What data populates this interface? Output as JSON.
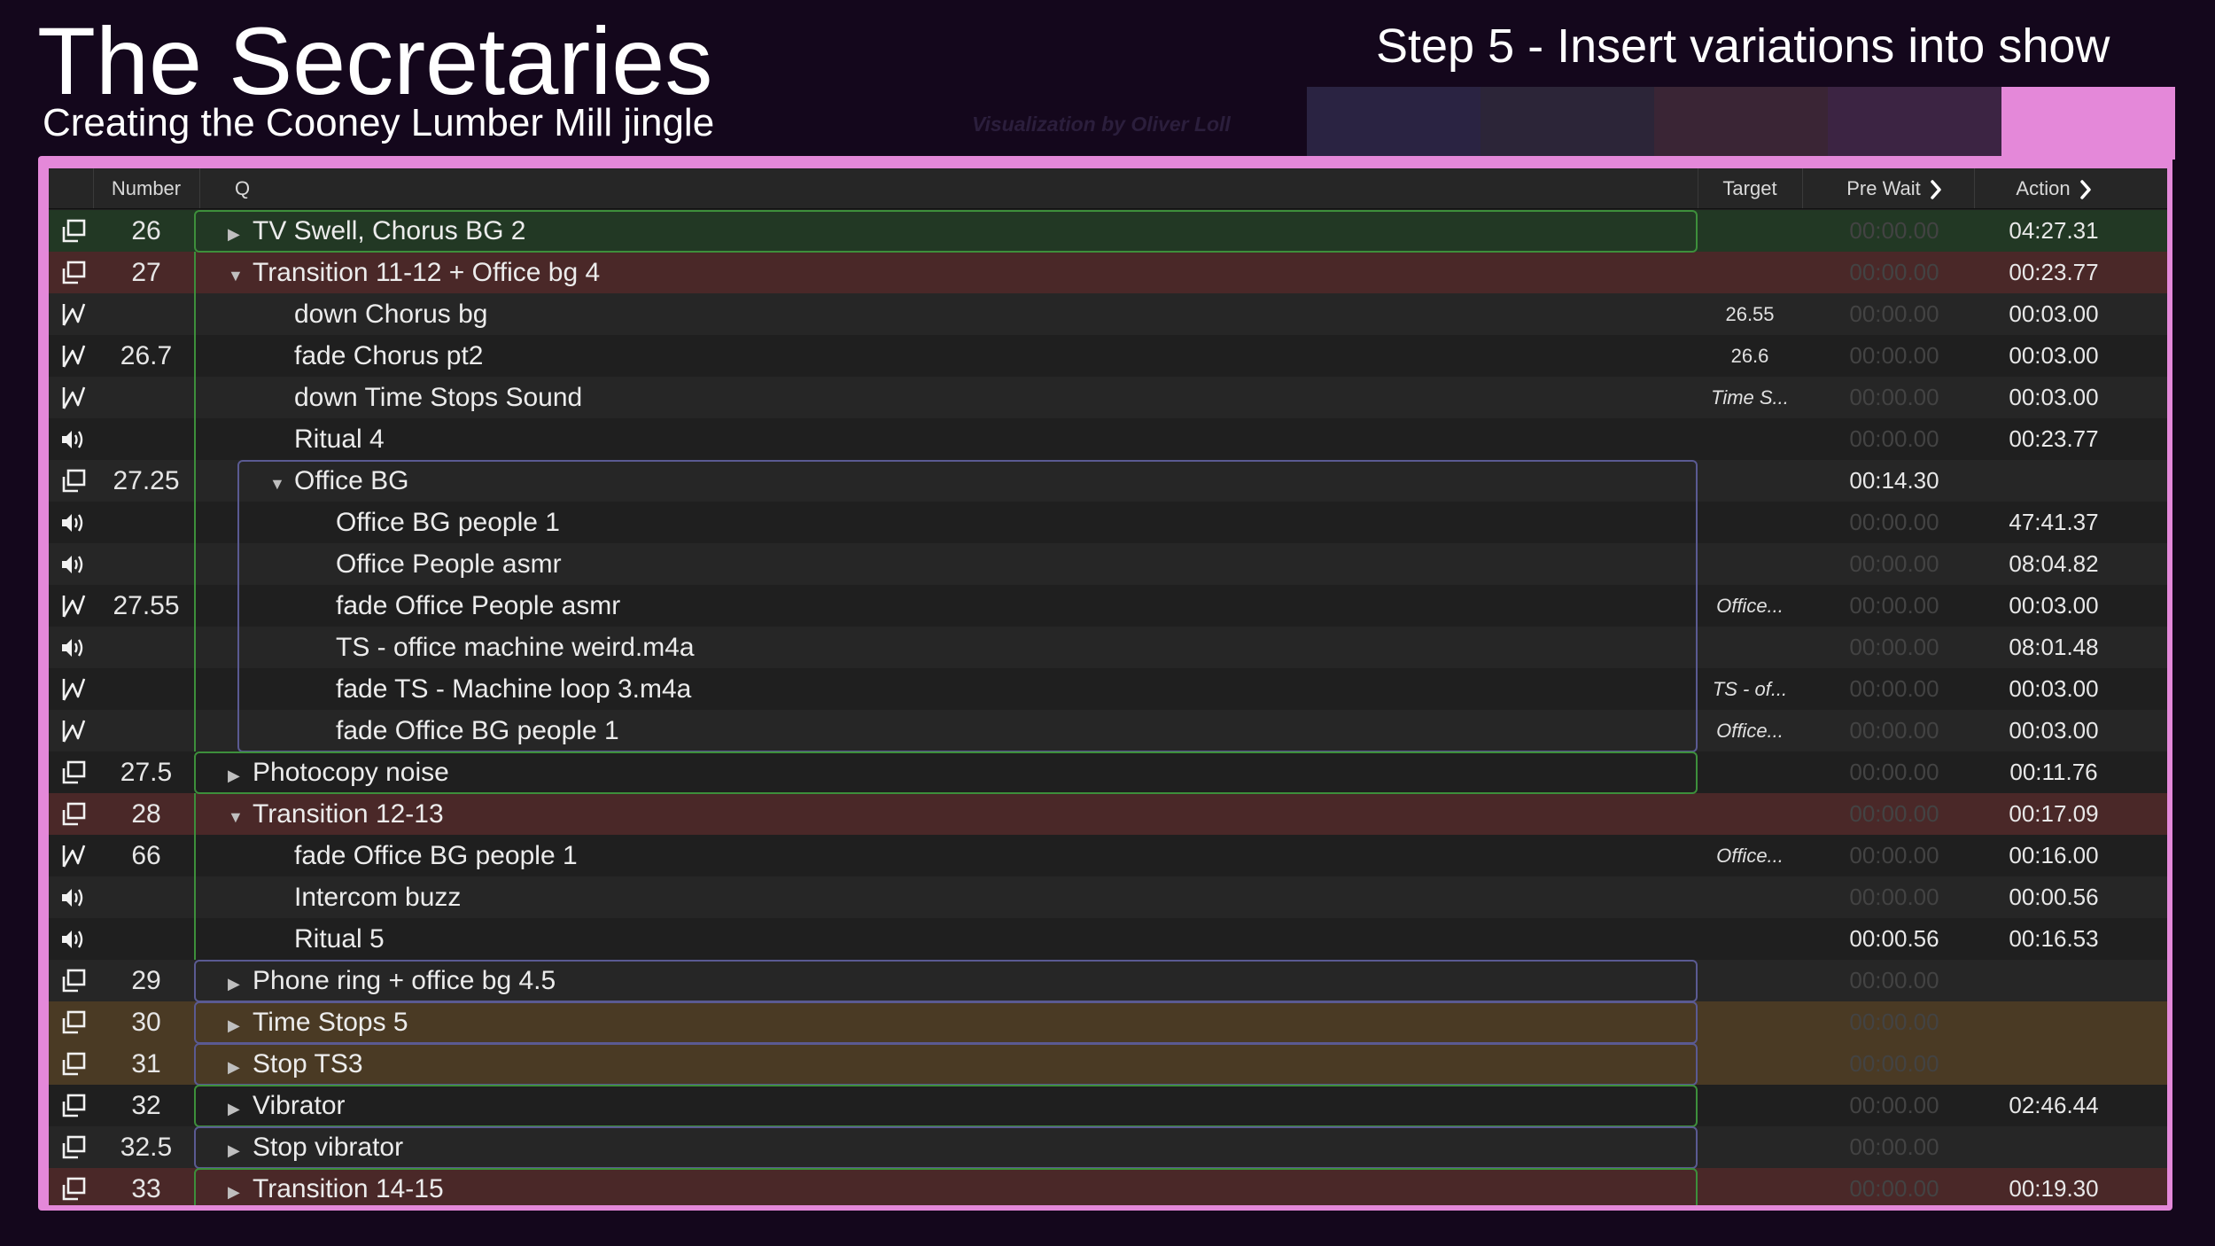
{
  "header": {
    "title": "The Secretaries",
    "subtitle": "Creating the Cooney Lumber Mill jingle",
    "step": "Step 5 - Insert variations into show",
    "credit": "Visualization by Oliver Loll"
  },
  "colors": {
    "frame": "#e488d9",
    "row_green": "#223824",
    "row_red": "#4a2828",
    "row_orange": "#4a3a24",
    "group_green": "#3d8f3b",
    "group_blue": "#5a5a92",
    "swatches": [
      "#2a2342",
      "#2c2538",
      "#3a2535",
      "#3c2443"
    ]
  },
  "columns": {
    "number": "Number",
    "q": "Q",
    "target": "Target",
    "pre_wait": "Pre Wait",
    "action": "Action"
  },
  "rows": [
    {
      "icon": "group-icon",
      "number": "26",
      "name": "TV Swell, Chorus BG 2",
      "depth": 0,
      "disclosure": "collapsed",
      "target": "",
      "pre_wait": "00:00.00",
      "pre_dim": true,
      "action": "04:27.31",
      "tint": "row_green"
    },
    {
      "icon": "group-icon",
      "number": "27",
      "name": "Transition 11-12 + Office bg 4",
      "depth": 0,
      "disclosure": "expanded",
      "target": "",
      "pre_wait": "00:00.00",
      "pre_dim": true,
      "action": "00:23.77",
      "tint": "row_red"
    },
    {
      "icon": "fade-icon",
      "number": "",
      "name": "down Chorus bg",
      "depth": 1,
      "disclosure": "",
      "target": "26.55",
      "target_italic": false,
      "pre_wait": "00:00.00",
      "pre_dim": true,
      "action": "00:03.00",
      "tint": ""
    },
    {
      "icon": "fade-icon",
      "number": "26.7",
      "name": "fade Chorus pt2",
      "depth": 1,
      "disclosure": "",
      "target": "26.6",
      "target_italic": false,
      "pre_wait": "00:00.00",
      "pre_dim": true,
      "action": "00:03.00",
      "tint": ""
    },
    {
      "icon": "fade-icon",
      "number": "",
      "name": "down Time Stops Sound",
      "depth": 1,
      "disclosure": "",
      "target": "Time S...",
      "target_italic": true,
      "pre_wait": "00:00.00",
      "pre_dim": true,
      "action": "00:03.00",
      "tint": ""
    },
    {
      "icon": "audio-icon",
      "number": "",
      "name": "Ritual 4",
      "depth": 1,
      "disclosure": "",
      "target": "",
      "pre_wait": "00:00.00",
      "pre_dim": true,
      "action": "00:23.77",
      "tint": ""
    },
    {
      "icon": "group-icon",
      "number": "27.25",
      "name": "Office BG",
      "depth": 1,
      "disclosure": "expanded",
      "target": "",
      "pre_wait": "00:14.30",
      "pre_dim": false,
      "action": "",
      "tint": ""
    },
    {
      "icon": "audio-icon",
      "number": "",
      "name": "Office BG people 1",
      "depth": 2,
      "disclosure": "",
      "target": "",
      "pre_wait": "00:00.00",
      "pre_dim": true,
      "action": "47:41.37",
      "tint": ""
    },
    {
      "icon": "audio-icon",
      "number": "",
      "name": "Office People asmr",
      "depth": 2,
      "disclosure": "",
      "target": "",
      "pre_wait": "00:00.00",
      "pre_dim": true,
      "action": "08:04.82",
      "tint": ""
    },
    {
      "icon": "fade-icon",
      "number": "27.55",
      "name": "fade Office People asmr",
      "depth": 2,
      "disclosure": "",
      "target": "Office...",
      "target_italic": true,
      "pre_wait": "00:00.00",
      "pre_dim": true,
      "action": "00:03.00",
      "tint": ""
    },
    {
      "icon": "audio-icon",
      "number": "",
      "name": "TS - office machine weird.m4a",
      "depth": 2,
      "disclosure": "",
      "target": "",
      "pre_wait": "00:00.00",
      "pre_dim": true,
      "action": "08:01.48",
      "tint": ""
    },
    {
      "icon": "fade-icon",
      "number": "",
      "name": "fade TS - Machine loop 3.m4a",
      "depth": 2,
      "disclosure": "",
      "target": "TS - of...",
      "target_italic": true,
      "pre_wait": "00:00.00",
      "pre_dim": true,
      "action": "00:03.00",
      "tint": ""
    },
    {
      "icon": "fade-icon",
      "number": "",
      "name": "fade Office BG people 1",
      "depth": 2,
      "disclosure": "",
      "target": "Office...",
      "target_italic": true,
      "pre_wait": "00:00.00",
      "pre_dim": true,
      "action": "00:03.00",
      "tint": ""
    },
    {
      "icon": "group-icon",
      "number": "27.5",
      "name": "Photocopy noise",
      "depth": 0,
      "disclosure": "collapsed",
      "target": "",
      "pre_wait": "00:00.00",
      "pre_dim": true,
      "action": "00:11.76",
      "tint": ""
    },
    {
      "icon": "group-icon",
      "number": "28",
      "name": "Transition 12-13",
      "depth": 0,
      "disclosure": "expanded",
      "target": "",
      "pre_wait": "00:00.00",
      "pre_dim": true,
      "action": "00:17.09",
      "tint": "row_red"
    },
    {
      "icon": "fade-icon",
      "number": "66",
      "name": "fade Office BG people 1",
      "depth": 1,
      "disclosure": "",
      "target": "Office...",
      "target_italic": true,
      "pre_wait": "00:00.00",
      "pre_dim": true,
      "action": "00:16.00",
      "tint": ""
    },
    {
      "icon": "audio-icon",
      "number": "",
      "name": "Intercom buzz",
      "depth": 1,
      "disclosure": "",
      "target": "",
      "pre_wait": "00:00.00",
      "pre_dim": true,
      "action": "00:00.56",
      "tint": ""
    },
    {
      "icon": "audio-icon",
      "number": "",
      "name": "Ritual 5",
      "depth": 1,
      "disclosure": "",
      "target": "",
      "pre_wait": "00:00.56",
      "pre_dim": false,
      "action": "00:16.53",
      "tint": ""
    },
    {
      "icon": "group-icon",
      "number": "29",
      "name": "Phone ring + office bg 4.5",
      "depth": 0,
      "disclosure": "collapsed",
      "target": "",
      "pre_wait": "00:00.00",
      "pre_dim": true,
      "action": "",
      "tint": ""
    },
    {
      "icon": "group-icon",
      "number": "30",
      "name": "Time Stops 5",
      "depth": 0,
      "disclosure": "collapsed",
      "target": "",
      "pre_wait": "00:00.00",
      "pre_dim": true,
      "action": "",
      "tint": "row_orange"
    },
    {
      "icon": "group-icon",
      "number": "31",
      "name": "Stop TS3",
      "depth": 0,
      "disclosure": "collapsed",
      "target": "",
      "pre_wait": "00:00.00",
      "pre_dim": true,
      "action": "",
      "tint": "row_orange"
    },
    {
      "icon": "group-icon",
      "number": "32",
      "name": "Vibrator",
      "depth": 0,
      "disclosure": "collapsed",
      "target": "",
      "pre_wait": "00:00.00",
      "pre_dim": true,
      "action": "02:46.44",
      "tint": ""
    },
    {
      "icon": "group-icon",
      "number": "32.5",
      "name": "Stop vibrator",
      "depth": 0,
      "disclosure": "collapsed",
      "target": "",
      "pre_wait": "00:00.00",
      "pre_dim": true,
      "action": "",
      "tint": ""
    },
    {
      "icon": "group-icon",
      "number": "33",
      "name": "Transition 14-15",
      "depth": 0,
      "disclosure": "collapsed",
      "target": "",
      "pre_wait": "00:00.00",
      "pre_dim": true,
      "action": "00:19.30",
      "tint": "row_red"
    }
  ]
}
